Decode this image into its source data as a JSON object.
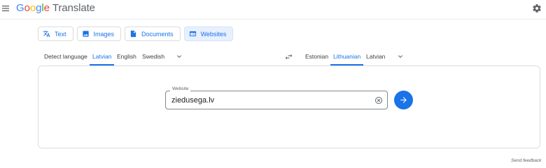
{
  "header": {
    "logo_letters": [
      "G",
      "o",
      "o",
      "g",
      "l",
      "e"
    ],
    "product": "Translate"
  },
  "modes": [
    {
      "label": "Text",
      "icon": "translate-icon",
      "active": false
    },
    {
      "label": "Images",
      "icon": "image-icon",
      "active": false
    },
    {
      "label": "Documents",
      "icon": "document-icon",
      "active": false
    },
    {
      "label": "Websites",
      "icon": "website-icon",
      "active": true
    }
  ],
  "source_languages": [
    {
      "label": "Detect language",
      "selected": false
    },
    {
      "label": "Latvian",
      "selected": true
    },
    {
      "label": "English",
      "selected": false
    },
    {
      "label": "Swedish",
      "selected": false
    }
  ],
  "target_languages": [
    {
      "label": "Estonian",
      "selected": false
    },
    {
      "label": "Lithuanian",
      "selected": true
    },
    {
      "label": "Latvian",
      "selected": false
    }
  ],
  "website": {
    "label": "Website",
    "value": "ziedusega.lv"
  },
  "footer": {
    "feedback": "Send feedback"
  },
  "colors": {
    "accent": "#1a73e8",
    "active_tab_bg": "#e8f0fe",
    "border": "#dadce0"
  }
}
